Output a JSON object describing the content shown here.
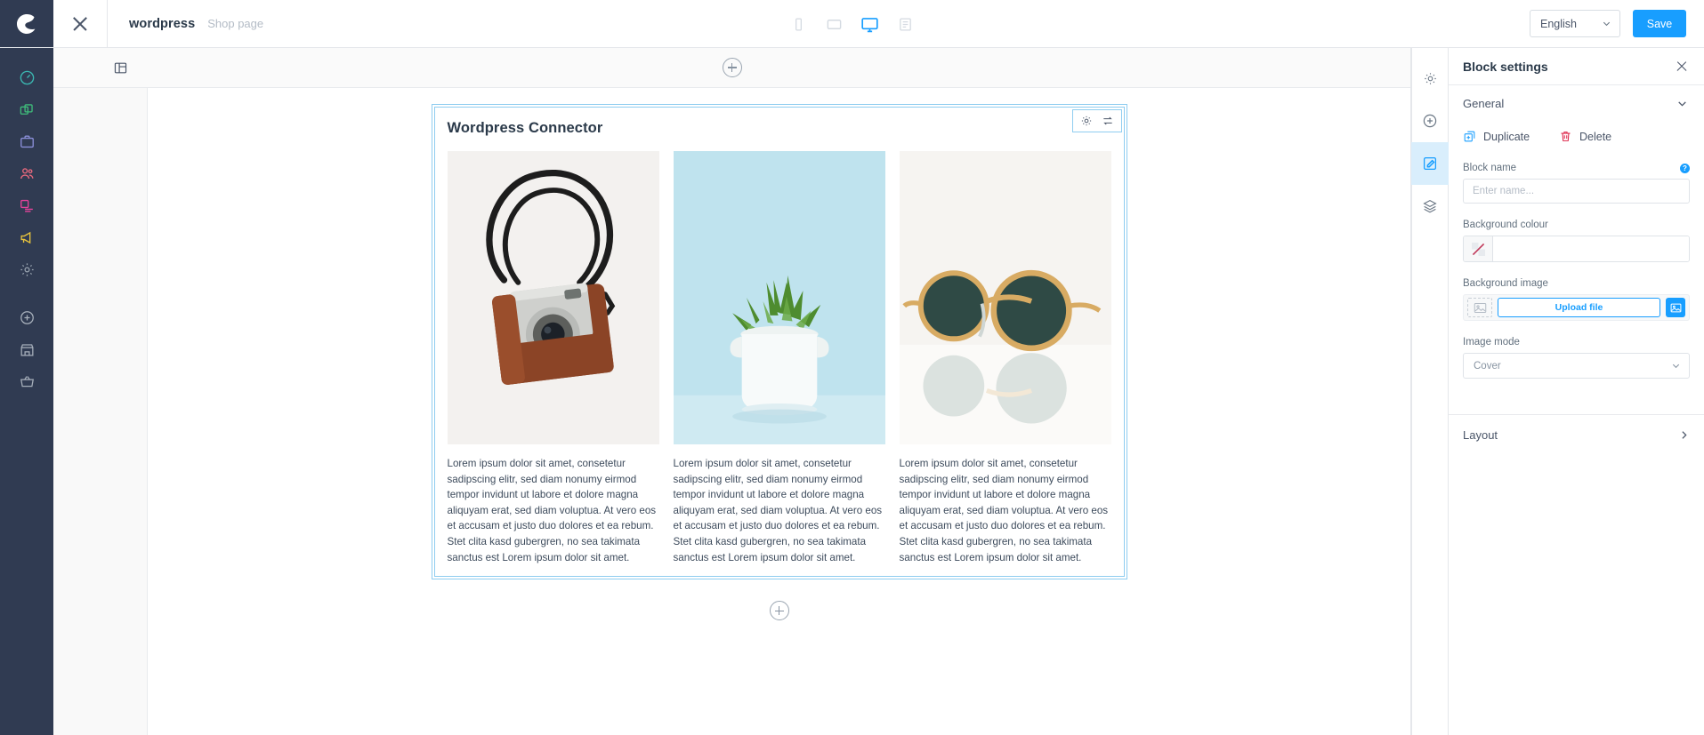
{
  "topbar": {
    "breadcrumb_main": "wordpress",
    "breadcrumb_sub": "Shop page",
    "devices": [
      {
        "name": "mobile-view",
        "label": "Mobile",
        "active": false
      },
      {
        "name": "tablet-view",
        "label": "Tablet",
        "active": false
      },
      {
        "name": "desktop-view",
        "label": "Desktop",
        "active": true
      },
      {
        "name": "list-view",
        "label": "List",
        "active": false
      }
    ],
    "language": "English",
    "save_label": "Save"
  },
  "leftnav": {
    "items": [
      {
        "name": "dashboard",
        "label": "Dashboard",
        "color": "#3bb8b2"
      },
      {
        "name": "catalogues",
        "label": "Catalogues",
        "color": "#3fbb7a"
      },
      {
        "name": "orders",
        "label": "Orders",
        "color": "#8a8ed8"
      },
      {
        "name": "customers",
        "label": "Customers",
        "color": "#e8697d"
      },
      {
        "name": "content",
        "label": "Content",
        "color": "#e5439b"
      },
      {
        "name": "marketing",
        "label": "Marketing",
        "color": "#e8c33c"
      },
      {
        "name": "settings",
        "label": "Settings",
        "color": "#9aa5b1"
      },
      {
        "name": "add",
        "label": "Add",
        "color": "#a7b0bb"
      },
      {
        "name": "store",
        "label": "Store",
        "color": "#a7b0bb"
      },
      {
        "name": "basket",
        "label": "Basket",
        "color": "#a7b0bb"
      }
    ]
  },
  "canvas": {
    "block_title": "Wordpress Connector",
    "columns": [
      {
        "image_name": "vintage-camera-photo",
        "image_alt": "Vintage camera with brown leather case and black strap",
        "text": "Lorem ipsum dolor sit amet, consetetur sadipscing elitr, sed diam nonumy eirmod tempor invidunt ut labore et dolore magna aliquyam erat, sed diam voluptua. At vero eos et accusam et justo duo dolores et ea rebum. Stet clita kasd gubergren, no sea takimata sanctus est Lorem ipsum dolor sit amet."
      },
      {
        "image_name": "succulent-plant-photo",
        "image_alt": "Succulent plant in white ceramic pot on light blue background",
        "text": "Lorem ipsum dolor sit amet, consetetur sadipscing elitr, sed diam nonumy eirmod tempor invidunt ut labore et dolore magna aliquyam erat, sed diam voluptua. At vero eos et accusam et justo duo dolores et ea rebum. Stet clita kasd gubergren, no sea takimata sanctus est Lorem ipsum dolor sit amet."
      },
      {
        "image_name": "sunglasses-photo",
        "image_alt": "Round gold-framed sunglasses with dark green lenses",
        "text": "Lorem ipsum dolor sit amet, consetetur sadipscing elitr, sed diam nonumy eirmod tempor invidunt ut labore et dolore magna aliquyam erat, sed diam voluptua. At vero eos et accusam et justo duo dolores et ea rebum. Stet clita kasd gubergren, no sea takimata sanctus est Lorem ipsum dolor sit amet."
      }
    ]
  },
  "rail": {
    "items": [
      {
        "name": "gear-icon",
        "label": "Section settings",
        "active": false
      },
      {
        "name": "plus-icon",
        "label": "Add element",
        "active": false
      },
      {
        "name": "edit-icon",
        "label": "Edit block",
        "active": true
      },
      {
        "name": "layers-icon",
        "label": "Layers",
        "active": false
      }
    ]
  },
  "panel": {
    "title": "Block settings",
    "general_label": "General",
    "duplicate_label": "Duplicate",
    "delete_label": "Delete",
    "block_name_label": "Block name",
    "block_name_value": "",
    "block_name_placeholder": "Enter name...",
    "background_colour_label": "Background colour",
    "background_colour_value": "",
    "background_image_label": "Background image",
    "upload_label": "Upload file",
    "image_mode_label": "Image mode",
    "image_mode_value": "Cover",
    "layout_label": "Layout"
  },
  "colors": {
    "accent": "#189eff",
    "sidebar_bg": "#303b52",
    "delete_red": "#de294c",
    "block_border": "#8fcdf0"
  }
}
